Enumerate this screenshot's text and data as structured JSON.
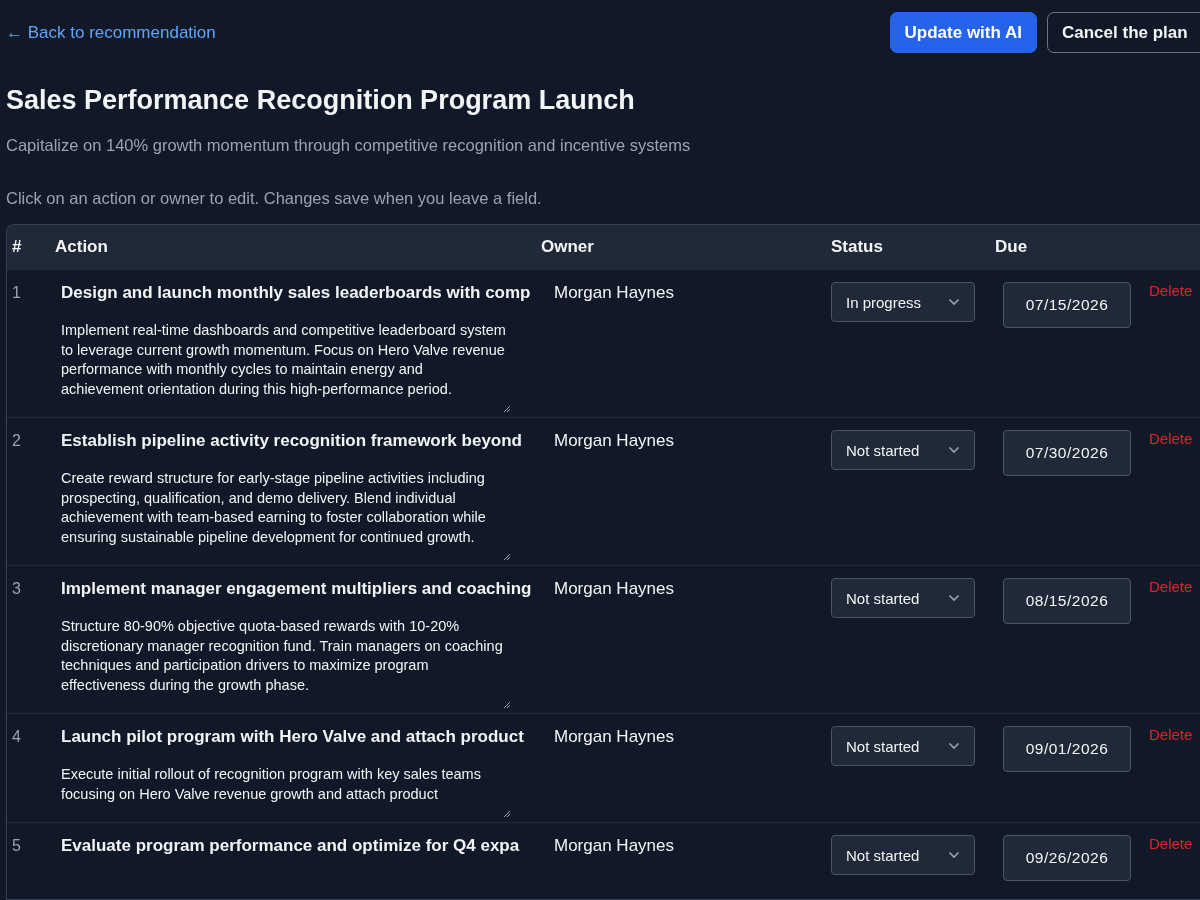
{
  "back_link": "← Back to recommendation",
  "buttons": [
    {
      "label": "Update with AI",
      "kind": "primary"
    },
    {
      "label": "Cancel the plan",
      "kind": "secondary"
    }
  ],
  "title": "Sales Performance Recognition Program Launch",
  "subtitle": "Capitalize on 140% growth momentum through competitive recognition and incentive systems",
  "hint": "Click on an action or owner to edit. Changes save when you leave a field.",
  "table": {
    "columns": [
      "#",
      "Action",
      "Owner",
      "Status",
      "Due"
    ],
    "rows": [
      {
        "number": "1",
        "title": "Design and launch monthly sales leaderboards with comp",
        "description": "Implement real-time dashboards and competitive leaderboard system to leverage current growth momentum. Focus on Hero Valve revenue performance with monthly cycles to maintain energy and achievement orientation during this high-performance period.",
        "owner": "Morgan Haynes",
        "status": "In progress",
        "due": "07/15/2026",
        "delete": "Delete"
      },
      {
        "number": "2",
        "title": "Establish pipeline activity recognition framework beyond",
        "description": "Create reward structure for early-stage pipeline activities including prospecting, qualification, and demo delivery. Blend individual achievement with team-based earning to foster collaboration while ensuring sustainable pipeline development for continued growth.",
        "owner": "Morgan Haynes",
        "status": "Not started",
        "due": "07/30/2026",
        "delete": "Delete"
      },
      {
        "number": "3",
        "title": "Implement manager engagement multipliers and coaching",
        "description": "Structure 80-90% objective quota-based rewards with 10-20% discretionary manager recognition fund. Train managers on coaching techniques and participation drivers to maximize program effectiveness during the growth phase.",
        "owner": "Morgan Haynes",
        "status": "Not started",
        "due": "08/15/2026",
        "delete": "Delete"
      },
      {
        "number": "4",
        "title": "Launch pilot program with Hero Valve and attach product",
        "description": "Execute initial rollout of recognition program with key sales teams focusing on Hero Valve revenue growth and attach product",
        "owner": "Morgan Haynes",
        "status": "Not started",
        "due": "09/01/2026",
        "delete": "Delete"
      },
      {
        "number": "5",
        "title": "Evaluate program performance and optimize for Q4 expa",
        "owner": "Morgan Haynes",
        "status": "Not started",
        "due": "09/26/2026",
        "delete": "Delete"
      }
    ]
  }
}
